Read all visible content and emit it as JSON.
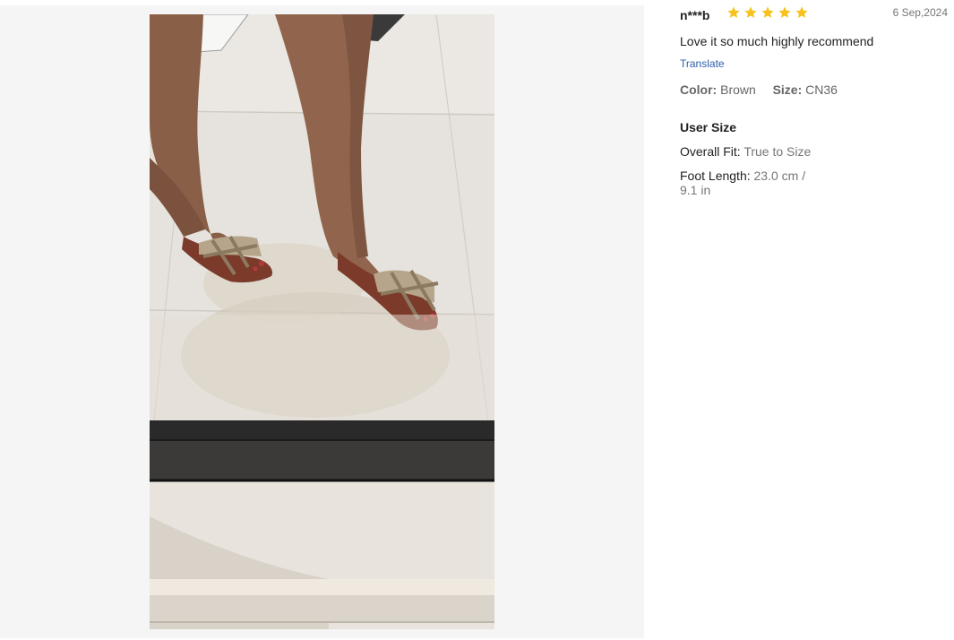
{
  "review": {
    "username": "n***b",
    "rating": 5,
    "date": "6 Sep,2024",
    "text": "Love it so much highly recommend",
    "translate_label": "Translate",
    "color_label": "Color:",
    "color_value": "Brown",
    "size_label": "Size:",
    "size_value": "CN36",
    "user_size_title": "User Size",
    "overall_fit_label": "Overall Fit:",
    "overall_fit_value": "True to Size",
    "foot_length_label": "Foot Length:",
    "foot_length_value": "23.0 cm / 9.1 in"
  },
  "colors": {
    "star": "#f6c21b",
    "viewer_bg": "#f5f5f5",
    "link": "#2e5fa8"
  },
  "icons": {
    "star": "star-icon"
  }
}
